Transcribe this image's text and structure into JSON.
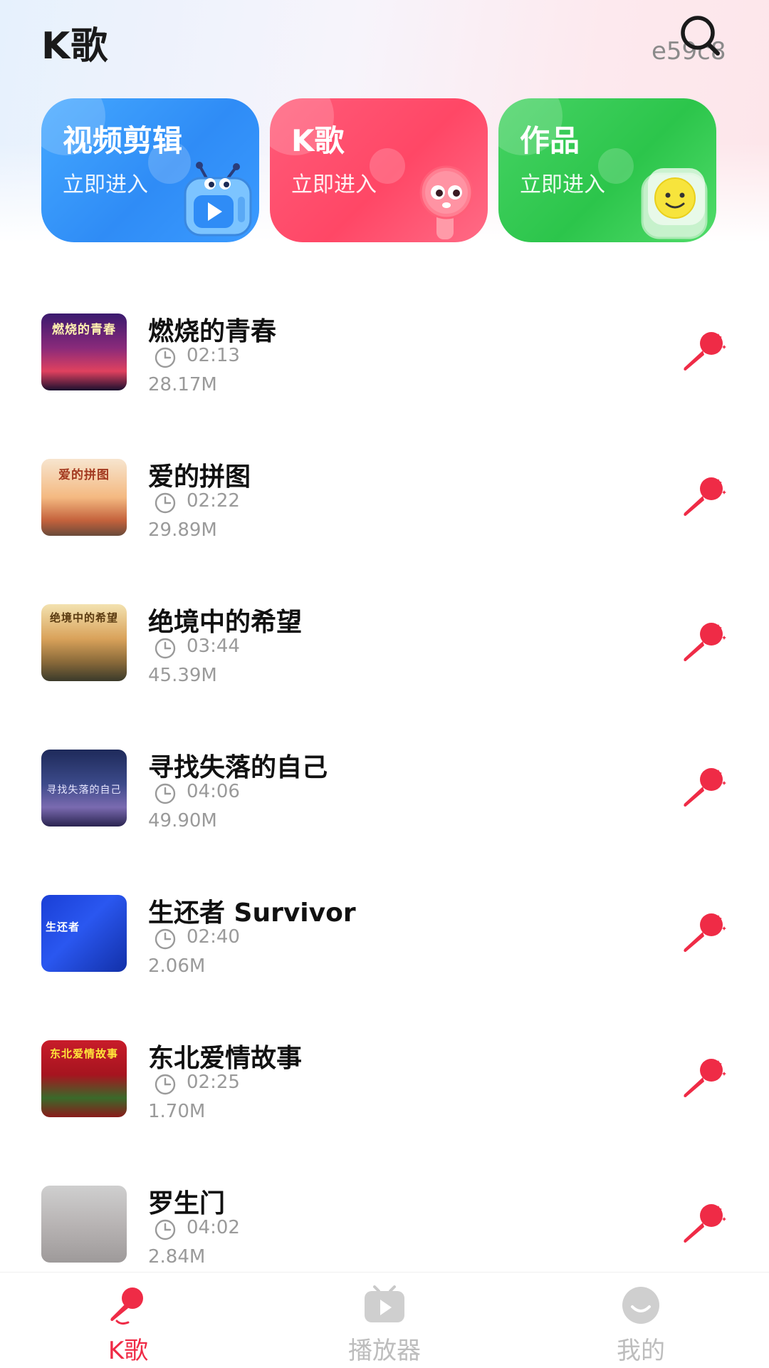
{
  "header": {
    "title": "K歌",
    "watermark": "e59c8"
  },
  "cards": [
    {
      "title": "视频剪辑",
      "subtitle": "立即进入",
      "icon": "tv-mascot-icon"
    },
    {
      "title": "K歌",
      "subtitle": "立即进入",
      "icon": "microphone-mascot-icon"
    },
    {
      "title": "作品",
      "subtitle": "立即进入",
      "icon": "smiley-mascot-icon"
    }
  ],
  "songs": [
    {
      "title": "燃烧的青春",
      "duration": "02:13",
      "size": "28.17M",
      "cover_text": "燃烧的青春"
    },
    {
      "title": "爱的拼图",
      "duration": "02:22",
      "size": "29.89M",
      "cover_text": "爱的拼图"
    },
    {
      "title": "绝境中的希望",
      "duration": "03:44",
      "size": "45.39M",
      "cover_text": "绝境中的希望"
    },
    {
      "title": "寻找失落的自己",
      "duration": "04:06",
      "size": "49.90M",
      "cover_text": "寻找失落的自己"
    },
    {
      "title": "生还者 Survivor",
      "duration": "02:40",
      "size": "2.06M",
      "cover_text": "生还者"
    },
    {
      "title": "东北爱情故事",
      "duration": "02:25",
      "size": "1.70M",
      "cover_text": "东北爱情故事"
    },
    {
      "title": "罗生门",
      "duration": "04:02",
      "size": "2.84M",
      "cover_text": ""
    }
  ],
  "tabs": [
    {
      "label": "K歌",
      "active": true,
      "icon": "microphone-icon"
    },
    {
      "label": "播放器",
      "active": false,
      "icon": "tv-play-icon"
    },
    {
      "label": "我的",
      "active": false,
      "icon": "smile-face-icon"
    }
  ],
  "colors": {
    "accent": "#ef2b46",
    "card_blue": "#3d9cff",
    "card_red": "#ff4d6d",
    "card_green": "#36cc56"
  }
}
